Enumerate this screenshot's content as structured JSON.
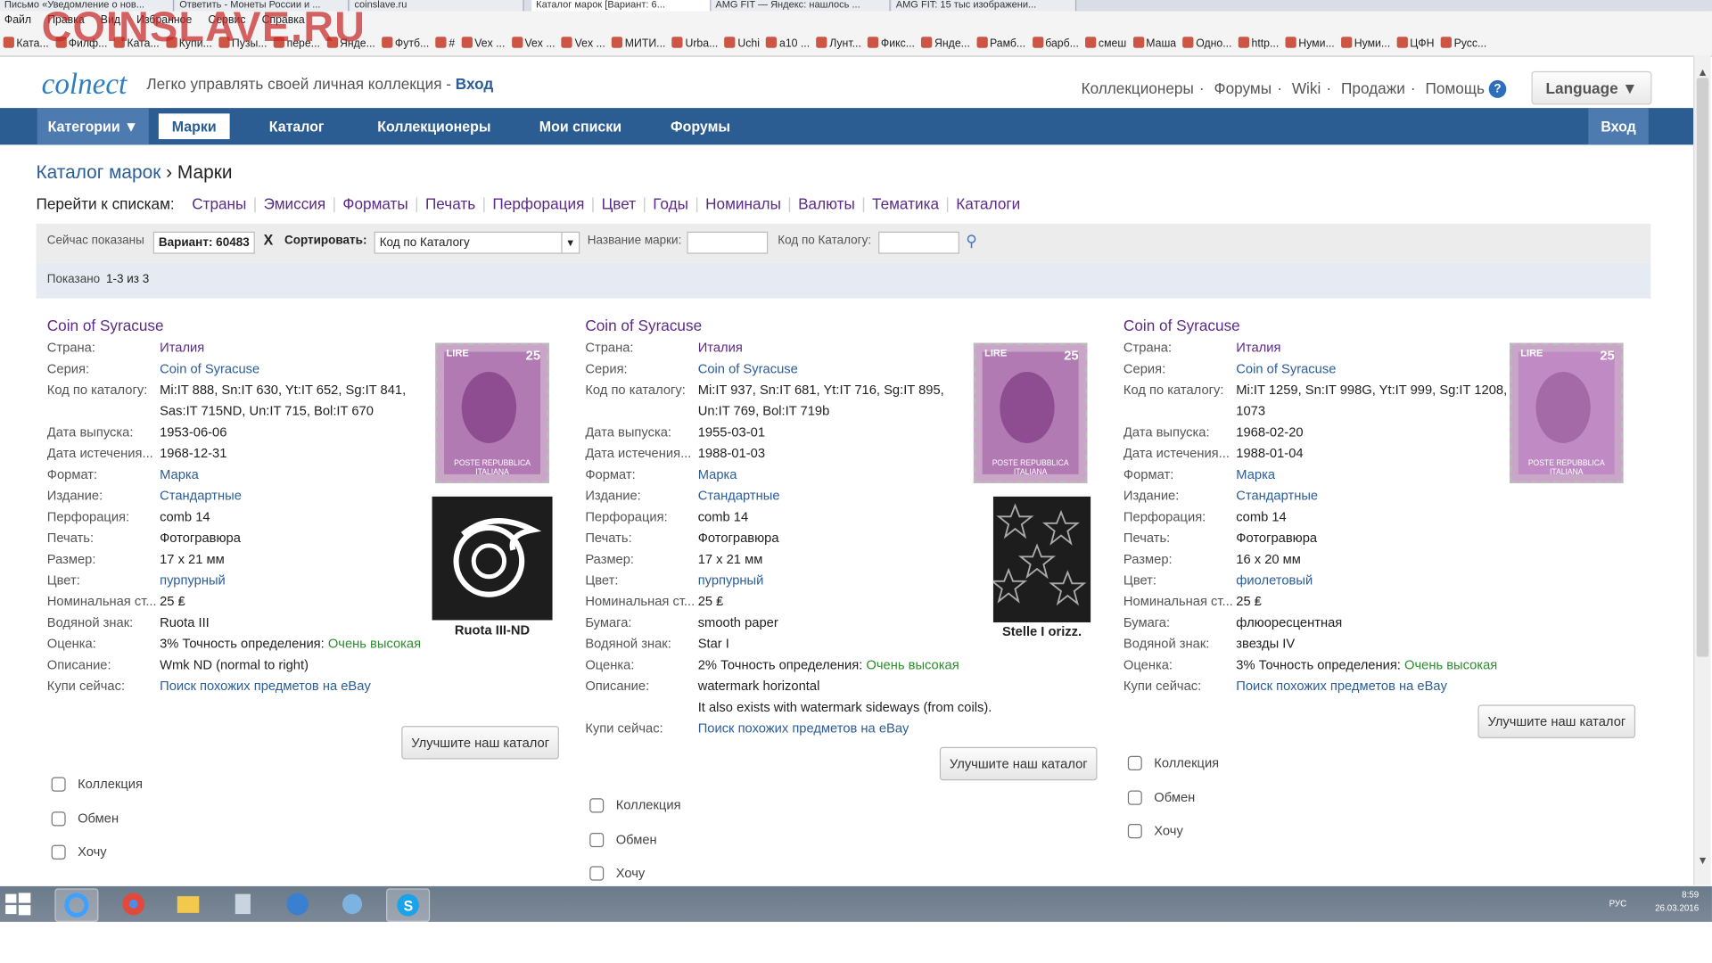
{
  "browser": {
    "tabs": [
      "Письмо «Уведомление о нов...",
      "Ответить - Монеты России и ...",
      "coinslave.ru",
      "Каталог марок [Вариант: 6...",
      "AMG FIT — Яндекс: нашлось ...",
      "AMG FIT: 15 тыс изображени..."
    ],
    "menu": [
      "Файл",
      "Правка",
      "Вид",
      "Избранное",
      "Сервис",
      "Справка"
    ],
    "favorites": [
      "Ката...",
      "Филф...",
      "Ката...",
      "Купи...",
      "Пузы...",
      "пере...",
      "Янде...",
      "Футб...",
      "#",
      "Vex ...",
      "Vex ...",
      "Vex ...",
      "МИТИ...",
      "Urba...",
      "Uchi",
      "а10 ...",
      "Лунт...",
      "Фикс...",
      "Янде...",
      "Рамб...",
      "барб...",
      "смеш",
      "Маша",
      "Одно...",
      "http...",
      "Нуми...",
      "Нуми...",
      "ЦФН",
      "Русс..."
    ],
    "watermark": "COINSLAVE.RU"
  },
  "header": {
    "logo": "colnect",
    "tagline": "Легко управлять своей личная коллекция -",
    "login_link": "Вход",
    "top_links": [
      "Коллекционеры",
      "Форумы",
      "Wiki",
      "Продажи",
      "Помощь"
    ],
    "help_icon": "?",
    "language": "Language ▼"
  },
  "nav": {
    "categories": "Категории ▼",
    "items": [
      "Марки",
      "Каталог",
      "Коллекционеры",
      "Мои списки",
      "Форумы"
    ],
    "login": "Вход"
  },
  "breadcrumb": {
    "parent": "Каталог марок",
    "sep": "›",
    "current": "Марки"
  },
  "goto": {
    "label": "Перейти к спискам:",
    "links": [
      "Страны",
      "Эмиссия",
      "Форматы",
      "Печать",
      "Перфорация",
      "Цвет",
      "Годы",
      "Номиналы",
      "Валюты",
      "Тематика",
      "Каталоги"
    ]
  },
  "filter": {
    "now_shown": "Сейчас показаны",
    "variant": "Вариант: 60483",
    "clear": "X",
    "sort_label": "Сортировать:",
    "sort_value": "Код по Каталогу",
    "name_label": "Название марки:",
    "code_label": "Код по Каталогу:"
  },
  "shown": {
    "label": "Показано",
    "value": "1-3 из 3"
  },
  "common": {
    "improve": "Улучшите наш каталог",
    "collection": "Коллекция",
    "exchange": "Обмен",
    "want": "Хочу",
    "stamp_lire": "LIRE",
    "stamp_den": "25",
    "stamp_rep": "POSTE REPUBBLICA ITALIANA"
  },
  "items": [
    {
      "title": "Coin of Syracuse",
      "rows": [
        {
          "label": "Страна:",
          "value": "Италия"
        },
        {
          "label": "Серия:",
          "value": "Coin of Syracuse"
        },
        {
          "label": "Код по каталогу:",
          "value": "Mi:IT 888, Sn:IT 630, Yt:IT 652, Sg:IT 841, Sas:IT 715ND, Un:IT 715, Bol:IT 670"
        },
        {
          "label": "Дата выпуска:",
          "value": "1953-06-06"
        },
        {
          "label": "Дата истечения...",
          "value": "1968-12-31"
        },
        {
          "label": "Формат:",
          "value": "Марка"
        },
        {
          "label": "Издание:",
          "value": "Стандартные"
        },
        {
          "label": "Перфорация:",
          "value": "comb 14"
        },
        {
          "label": "Печать:",
          "value": "Фотогравюра"
        },
        {
          "label": "Размер:",
          "value": "17 x 21 мм"
        },
        {
          "label": "Цвет:",
          "value": "пурпурный"
        },
        {
          "label": "Номинальная ст...",
          "value": "25 ₤"
        },
        {
          "label": "Водяной знак:",
          "value": "Ruota III"
        },
        {
          "label": "Оценка:",
          "value": "3% Точность определения:",
          "extra": "Очень высокая"
        },
        {
          "label": "Описание:",
          "value": "Wmk ND (normal to right)"
        },
        {
          "label": "Купи сейчас:",
          "value": "Поиск похожих предметов на eBay"
        }
      ],
      "wmk_caption": "Ruota III-ND"
    },
    {
      "title": "Coin of Syracuse",
      "rows": [
        {
          "label": "Страна:",
          "value": "Италия"
        },
        {
          "label": "Серия:",
          "value": "Coin of Syracuse"
        },
        {
          "label": "Код по каталогу:",
          "value": "Mi:IT 937, Sn:IT 681, Yt:IT 716, Sg:IT 895, Un:IT 769, Bol:IT 719b"
        },
        {
          "label": "Дата выпуска:",
          "value": "1955-03-01"
        },
        {
          "label": "Дата истечения...",
          "value": "1988-01-03"
        },
        {
          "label": "Формат:",
          "value": "Марка"
        },
        {
          "label": "Издание:",
          "value": "Стандартные"
        },
        {
          "label": "Перфорация:",
          "value": "comb 14"
        },
        {
          "label": "Печать:",
          "value": "Фотогравюра"
        },
        {
          "label": "Размер:",
          "value": "17 x 21 мм"
        },
        {
          "label": "Цвет:",
          "value": "пурпурный"
        },
        {
          "label": "Номинальная ст...",
          "value": "25 ₤"
        },
        {
          "label": "Бумага:",
          "value": "smooth paper"
        },
        {
          "label": "Водяной знак:",
          "value": "Star I"
        },
        {
          "label": "Оценка:",
          "value": "2% Точность определения:",
          "extra": "Очень высокая"
        },
        {
          "label": "Описание:",
          "value": "watermark horizontal"
        },
        {
          "label": "",
          "value": "It also exists with watermark sideways (from coils)."
        },
        {
          "label": "Купи сейчас:",
          "value": "Поиск похожих предметов на eBay"
        }
      ],
      "wmk_caption": "Stelle I orizz."
    },
    {
      "title": "Coin of Syracuse",
      "rows": [
        {
          "label": "Страна:",
          "value": "Италия"
        },
        {
          "label": "Серия:",
          "value": "Coin of Syracuse"
        },
        {
          "label": "Код по каталогу:",
          "value": "Mi:IT 1259, Sn:IT 998G, Yt:IT 999, Sg:IT 1208, Un:IT 1073"
        },
        {
          "label": "Дата выпуска:",
          "value": "1968-02-20"
        },
        {
          "label": "Дата истечения...",
          "value": "1988-01-04"
        },
        {
          "label": "Формат:",
          "value": "Марка"
        },
        {
          "label": "Издание:",
          "value": "Стандартные"
        },
        {
          "label": "Перфорация:",
          "value": "comb 14"
        },
        {
          "label": "Печать:",
          "value": "Фотогравюра"
        },
        {
          "label": "Размер:",
          "value": "16 x 20 мм"
        },
        {
          "label": "Цвет:",
          "value": "фиолетовый"
        },
        {
          "label": "Номинальная ст...",
          "value": "25 ₤"
        },
        {
          "label": "Бумага:",
          "value": "флюоресцентная"
        },
        {
          "label": "Водяной знак:",
          "value": "звезды IV"
        },
        {
          "label": "Оценка:",
          "value": "3% Точность определения:",
          "extra": "Очень высокая"
        },
        {
          "label": "Купи сейчас:",
          "value": "Поиск похожих предметов на eBay"
        }
      ]
    }
  ],
  "taskbar": {
    "lang": "РУС",
    "time": "8:59",
    "date": "26.03.2016"
  }
}
